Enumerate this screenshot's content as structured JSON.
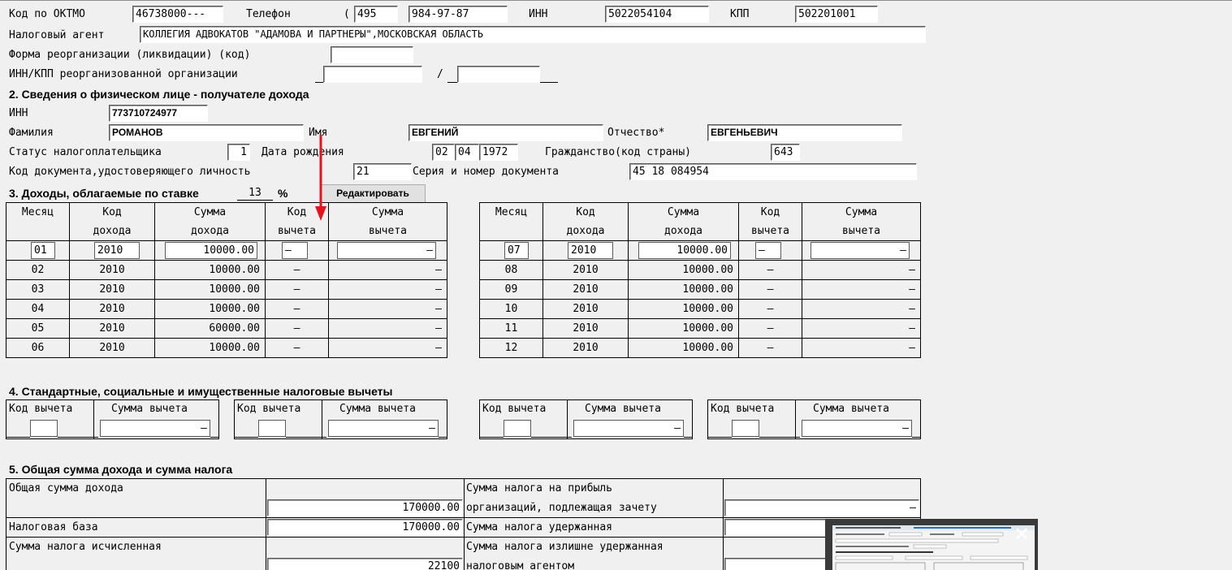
{
  "header": {
    "oktmo_label": "Код по ОКТМО",
    "oktmo_value": "46738000---",
    "phone_label": "Телефон",
    "phone_code": "495",
    "phone_number": "984-97-87",
    "inn_label": "ИНН",
    "inn_value": "5022054104",
    "kpp_label": "КПП",
    "kpp_value": "502201001",
    "agent_label": "Налоговый агент",
    "agent_value": "КОЛЛЕГИЯ АДВОКАТОВ \"АДАМОВА И ПАРТНЕРЫ\",МОСКОВСКАЯ ОБЛАСТЬ",
    "reorg_label": "Форма реорганизации (ликвидации) (код)",
    "reorg_value": "",
    "reorg_inn_label": "ИНН/КПП реорганизованной организации",
    "reorg_sep": "/"
  },
  "section2": {
    "title": "2. Сведения о физическом лице - получателе дохода",
    "inn_label": "ИНН",
    "inn_value": "773710724977",
    "surname_label": "Фамилия",
    "surname_value": "РОМАНОВ",
    "name_label": "Имя",
    "name_value": "ЕВГЕНИЙ",
    "patronymic_label": "Отчество*",
    "patronymic_value": "ЕВГЕНЬЕВИЧ",
    "status_label": "Статус налогоплательщика",
    "status_value": "1",
    "birth_label": "Дата рождения",
    "birth_day": "02",
    "birth_month": "04",
    "birth_year": "1972",
    "citizenship_label": "Гражданство(код страны)",
    "citizenship_value": "643",
    "doc_code_label": "Код документа,удостоверяющего личность",
    "doc_code_value": "21",
    "doc_series_label": "Серия и номер документа",
    "doc_series_value": "45 18 084954"
  },
  "section3": {
    "title": "3. Доходы,  облагаемые по ставке",
    "rate": "13",
    "percent": "%",
    "edit_button": "Редактировать",
    "headers": {
      "month": "Месяц",
      "code1": "Код",
      "code2": "дохода",
      "sum1": "Сумма",
      "sum2": "дохода",
      "ded1": "Код",
      "ded2": "вычета",
      "dsum1": "Сумма",
      "dsum2": "вычета"
    },
    "left_rows": [
      {
        "month": "01",
        "code": "2010",
        "sum": "10000.00",
        "ded": "–",
        "dsum": "–"
      },
      {
        "month": "02",
        "code": "2010",
        "sum": "10000.00",
        "ded": "–",
        "dsum": "–"
      },
      {
        "month": "03",
        "code": "2010",
        "sum": "10000.00",
        "ded": "–",
        "dsum": "–"
      },
      {
        "month": "04",
        "code": "2010",
        "sum": "10000.00",
        "ded": "–",
        "dsum": "–"
      },
      {
        "month": "05",
        "code": "2010",
        "sum": "60000.00",
        "ded": "–",
        "dsum": "–"
      },
      {
        "month": "06",
        "code": "2010",
        "sum": "10000.00",
        "ded": "–",
        "dsum": "–"
      }
    ],
    "right_rows": [
      {
        "month": "07",
        "code": "2010",
        "sum": "10000.00",
        "ded": "–",
        "dsum": "–"
      },
      {
        "month": "08",
        "code": "2010",
        "sum": "10000.00",
        "ded": "–",
        "dsum": "–"
      },
      {
        "month": "09",
        "code": "2010",
        "sum": "10000.00",
        "ded": "–",
        "dsum": "–"
      },
      {
        "month": "10",
        "code": "2010",
        "sum": "10000.00",
        "ded": "–",
        "dsum": "–"
      },
      {
        "month": "11",
        "code": "2010",
        "sum": "10000.00",
        "ded": "–",
        "dsum": "–"
      },
      {
        "month": "12",
        "code": "2010",
        "sum": "10000.00",
        "ded": "–",
        "dsum": "–"
      }
    ]
  },
  "section4": {
    "title": "4. Стандартные,  социальные  и  имущественные  налоговые вычеты",
    "code_header": "Код вычета",
    "sum_header": "Сумма вычета",
    "dash": "–"
  },
  "section5": {
    "title": "5. Общая сумма дохода и сумма налога",
    "total_income_label": "Общая сумма дохода",
    "total_income_value": "170000.00",
    "tax_base_label": "Налоговая база",
    "tax_base_value": "170000.00",
    "tax_calc_label": "Сумма налога исчисленная",
    "tax_calc_value": "22100",
    "profit_tax_label1": "Сумма налога на прибыль",
    "profit_tax_label2": "организаций, подлежащая зачету",
    "profit_tax_value": "–",
    "withheld_label": "Сумма налога удержанная",
    "excess_label1": "Сумма налога излишне удержанная",
    "excess_label2": "налоговым агентом"
  },
  "preview": {
    "close_glyph": "✕"
  },
  "colors": {
    "background": "#f0f0f0",
    "annotation_arrow": "#e8141c"
  }
}
